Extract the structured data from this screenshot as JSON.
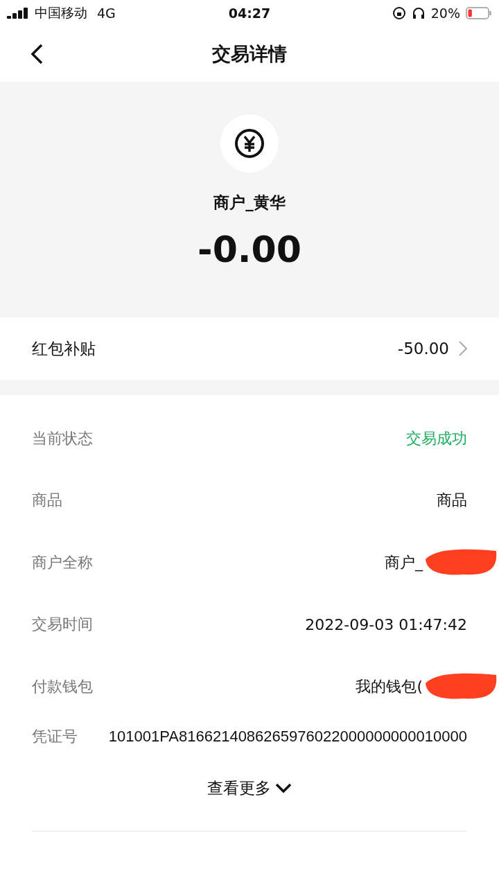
{
  "status_bar": {
    "carrier": "中国移动",
    "network": "4G",
    "time": "04:27",
    "battery": "20%"
  },
  "nav": {
    "title": "交易详情"
  },
  "header": {
    "merchant": "商户_黄华",
    "amount": "-0.00"
  },
  "subsidy": {
    "label": "红包补贴",
    "value": "-50.00"
  },
  "details": [
    {
      "label": "当前状态",
      "value": "交易成功",
      "color": "#1aad5b",
      "redacted": false
    },
    {
      "label": "商品",
      "value": "商品",
      "color": "#111111",
      "redacted": false
    },
    {
      "label": "商户全称",
      "value": "商户_",
      "color": "#111111",
      "redacted": true
    },
    {
      "label": "交易时间",
      "value": "2022-09-03 01:47:42",
      "color": "#111111",
      "redacted": false
    },
    {
      "label": "付款钱包",
      "value": "我的钱包(",
      "color": "#111111",
      "redacted": true
    }
  ],
  "voucher": {
    "label": "凭证号",
    "value": "101001PA8166214086265976022000000000010000"
  },
  "more_link": "查看更多"
}
